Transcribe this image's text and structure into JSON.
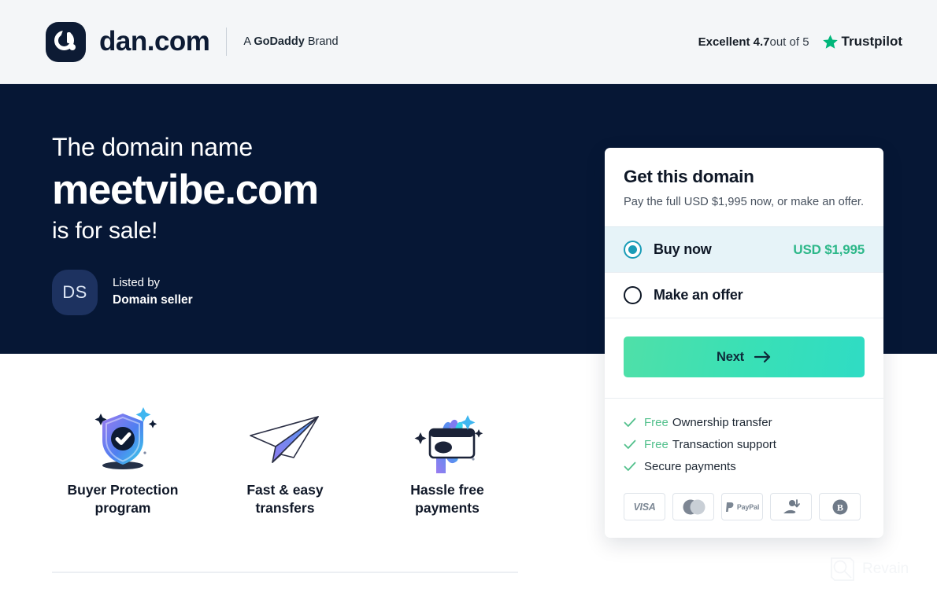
{
  "header": {
    "logo_word": "dan.com",
    "logo_icon": "dan-logo-mark",
    "brand_tagline_prefix": "A",
    "brand_tagline_brand": "GoDaddy",
    "brand_tagline_suffix": "Brand",
    "trustpilot": {
      "rating_text": "Excellent 4.7",
      "out_of_text": " out of 5",
      "logo_name": "Trustpilot",
      "star_icon": "trustpilot-star-icon",
      "star_color": "#00b67a"
    }
  },
  "hero": {
    "line1": "The domain name",
    "domain": "meetvibe.com",
    "line3": "is for sale!",
    "background_color": "#061735",
    "seller": {
      "avatar_initials": "DS",
      "listed_by_label": "Listed by",
      "seller_name": "Domain seller"
    }
  },
  "features": [
    {
      "icon": "shield-check-icon",
      "label_line1": "Buyer Protection",
      "label_line2": "program"
    },
    {
      "icon": "paper-plane-icon",
      "label_line1": "Fast & easy",
      "label_line2": "transfers"
    },
    {
      "icon": "hand-credit-card-icon",
      "label_line1": "Hassle free",
      "label_line2": "payments"
    }
  ],
  "card": {
    "title": "Get this domain",
    "subtitle": "Pay the full USD $1,995 now, or make an offer.",
    "options": [
      {
        "label": "Buy now",
        "price": "USD $1,995",
        "selected": true,
        "highlight_color": "#e6f3f8",
        "radio_color": "#1a9cb7",
        "price_color": "#2eb88a"
      },
      {
        "label": "Make an offer",
        "price": "",
        "selected": false
      }
    ],
    "next_button": {
      "label": "Next",
      "icon": "arrow-right-icon",
      "color_start": "#4fe0a8",
      "color_end": "#2fdcc4"
    },
    "perks": [
      {
        "check_icon": "check-icon",
        "free_label": "Free",
        "text": "Ownership transfer"
      },
      {
        "check_icon": "check-icon",
        "free_label": "Free",
        "text": "Transaction support"
      },
      {
        "check_icon": "check-icon",
        "free_label": "",
        "text": "Secure payments"
      }
    ],
    "payment_methods": [
      {
        "icon": "visa-icon",
        "label": "VISA"
      },
      {
        "icon": "mastercard-icon",
        "label": ""
      },
      {
        "icon": "paypal-icon",
        "label": "PayPal"
      },
      {
        "icon": "bank-transfer-icon",
        "label": ""
      },
      {
        "icon": "bitcoin-icon",
        "label": ""
      }
    ]
  },
  "watermark": {
    "text": "Revain",
    "icon": "revain-logo-icon"
  }
}
